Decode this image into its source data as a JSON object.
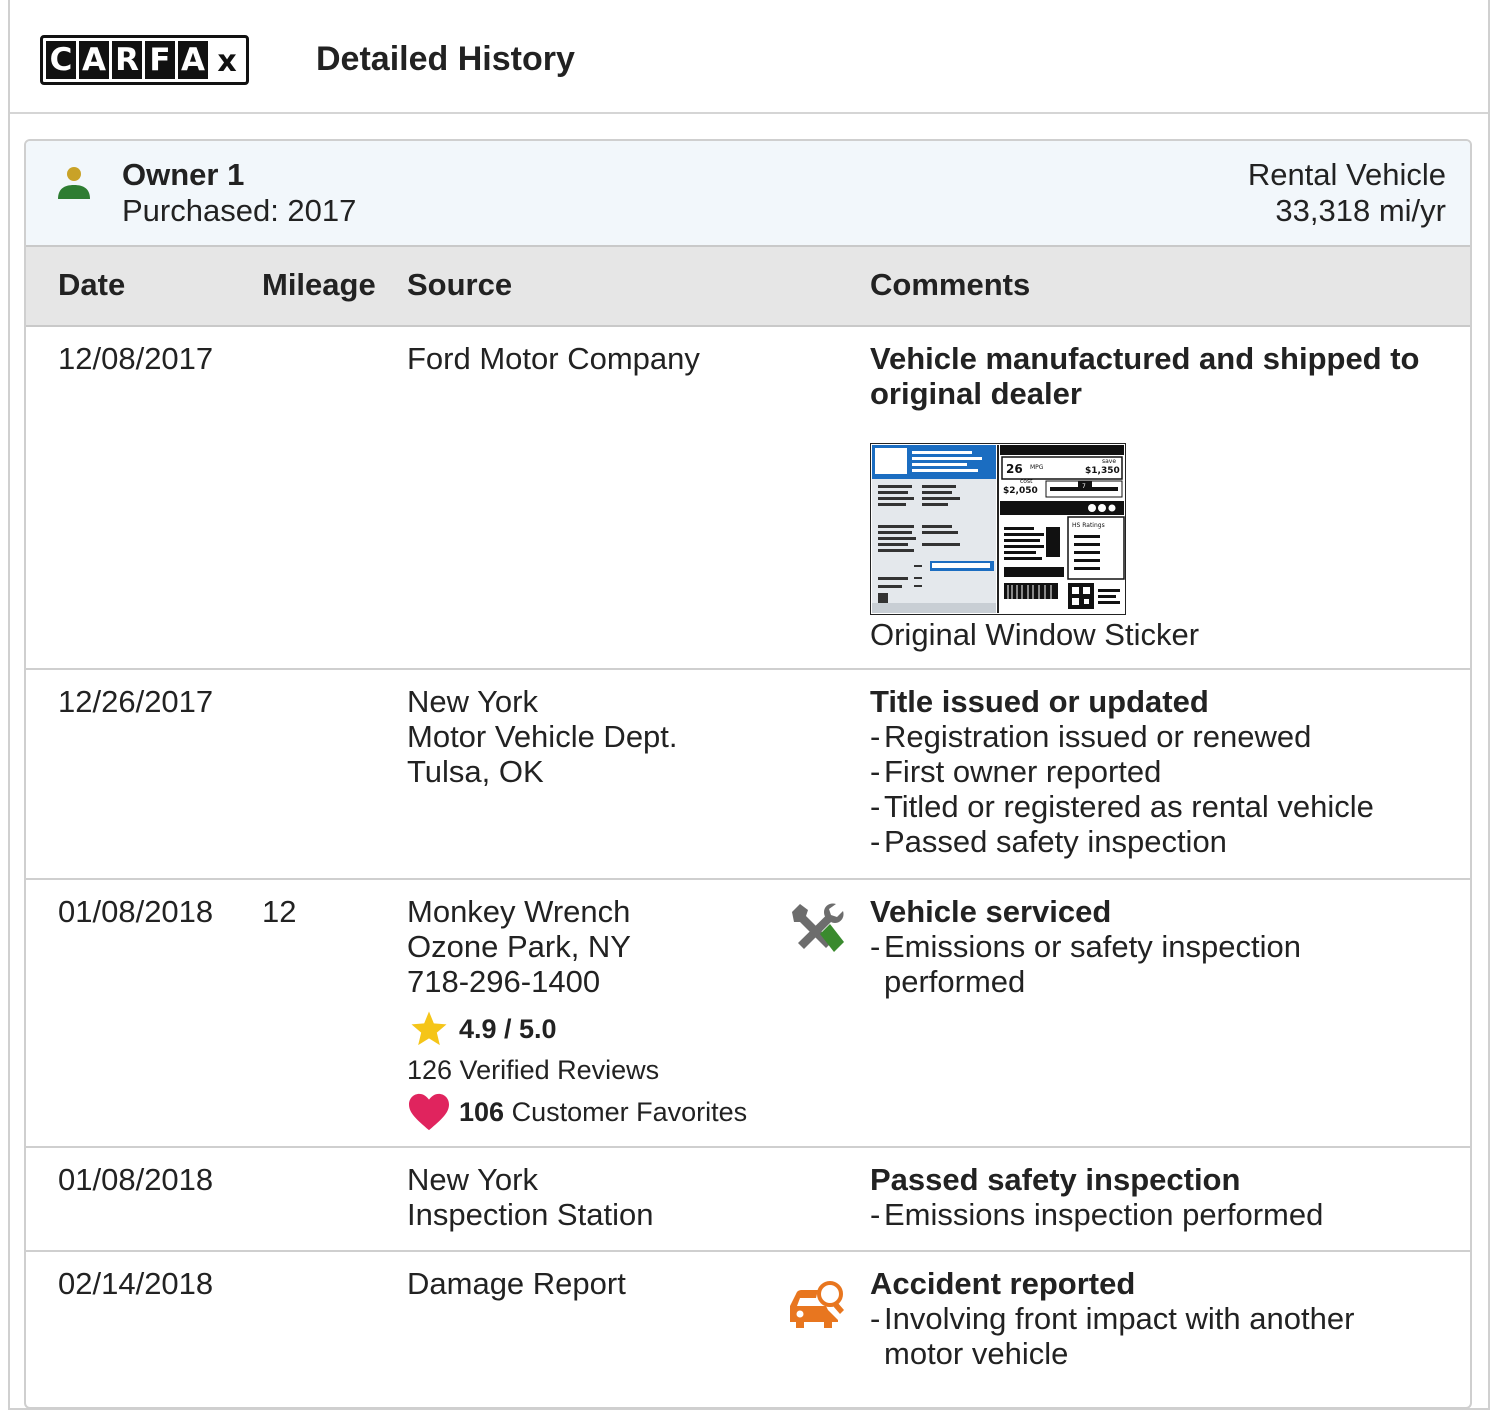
{
  "header": {
    "logo_letters": [
      "C",
      "A",
      "R",
      "F",
      "A",
      "x"
    ],
    "title": "Detailed History"
  },
  "owner": {
    "name": "Owner 1",
    "purchased": "Purchased: 2017",
    "type": "Rental Vehicle",
    "miles": "33,318 mi/yr",
    "icon": "person-icon"
  },
  "table": {
    "columns": [
      "Date",
      "Mileage",
      "Source",
      "Comments"
    ],
    "rows": [
      {
        "date": "12/08/2017",
        "mileage": "",
        "source": [
          "Ford Motor Company"
        ],
        "title": "Vehicle manufactured and shipped to original dealer",
        "items": [],
        "sticker": {
          "label": "Original Window Sticker",
          "mpg": "26",
          "mpg_unit": "MPG",
          "save_label": "save",
          "save": "$1,350",
          "cost_label": "cost",
          "cost": "$2,050",
          "ratings": "HS Ratings",
          "scale": "7"
        }
      },
      {
        "date": "12/26/2017",
        "mileage": "",
        "source": [
          "New York",
          "Motor Vehicle Dept.",
          "Tulsa, OK"
        ],
        "title": "Title issued or updated",
        "items": [
          "Registration issued or renewed",
          "First owner reported",
          "Titled or registered as rental vehicle",
          "Passed safety inspection"
        ]
      },
      {
        "date": "01/08/2018",
        "mileage": "12",
        "source": [
          "Monkey Wrench",
          "Ozone Park, NY",
          "718-296-1400"
        ],
        "rating": "4.9 / 5.0",
        "reviews": "126 Verified Reviews",
        "favorites_count": "106",
        "favorites_label": "Customer Favorites",
        "icon": "wrench-icon",
        "title": "Vehicle serviced",
        "items": [
          "Emissions or safety inspection performed"
        ]
      },
      {
        "date": "01/08/2018",
        "mileage": "",
        "source": [
          "New York",
          "Inspection Station"
        ],
        "title": "Passed safety inspection",
        "items": [
          "Emissions inspection performed"
        ]
      },
      {
        "date": "02/14/2018",
        "mileage": "",
        "source": [
          "Damage Report"
        ],
        "icon": "car-damage-icon",
        "title": "Accident reported",
        "items": [
          "Involving front impact with another motor vehicle"
        ]
      }
    ]
  },
  "colors": {
    "owner_bar": "#f2f7fb",
    "header_row": "#e6e6e6",
    "owner_icon_head": "#c9a227",
    "owner_icon_body": "#2e7d32",
    "star": "#f5c518",
    "heart": "#e0245e",
    "wrench_gray": "#6d6d6d",
    "wrench_green": "#3a8a2e",
    "accident_orange": "#e8761f",
    "sticker_blue": "#1b6dc1"
  }
}
